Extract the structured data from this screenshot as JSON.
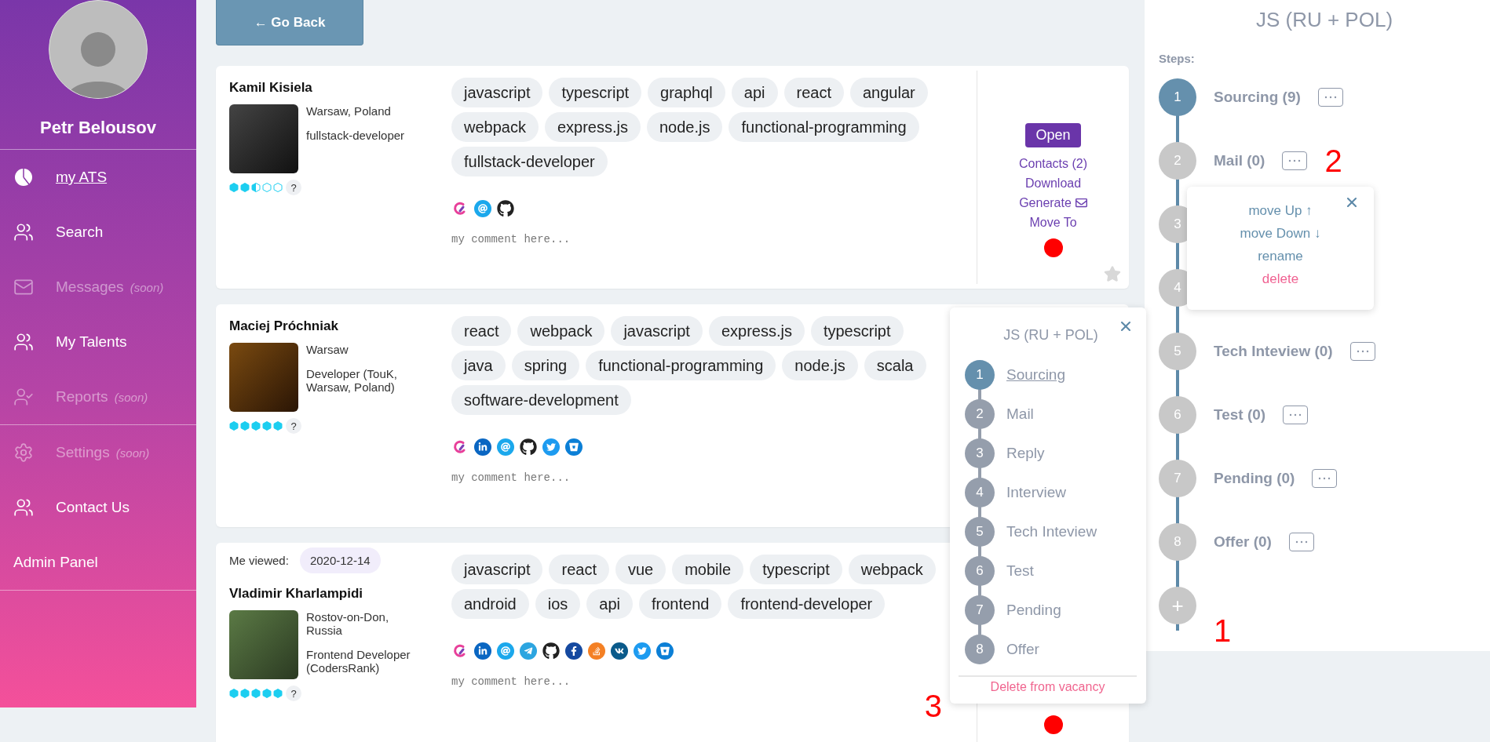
{
  "sidebar": {
    "user_name": "Petr Belousov",
    "groups": [
      [
        {
          "label": "my ATS",
          "kind": "chart",
          "selected": true,
          "disabled": false
        },
        {
          "label": "Search",
          "kind": "people",
          "selected": false,
          "disabled": false
        },
        {
          "label": "Messages",
          "note": "(soon)",
          "kind": "mail",
          "selected": false,
          "disabled": true
        },
        {
          "label": "My Talents",
          "kind": "people",
          "selected": false,
          "disabled": false
        },
        {
          "label": "Reports",
          "note": "(soon)",
          "kind": "person-check",
          "selected": false,
          "disabled": true
        }
      ],
      [
        {
          "label": "Settings",
          "note": "(soon)",
          "kind": "gear",
          "selected": false,
          "disabled": true
        },
        {
          "label": "Contact Us",
          "kind": "people",
          "selected": false,
          "disabled": false
        },
        {
          "label": "Admin Panel",
          "kind": "none",
          "selected": false,
          "disabled": false
        }
      ]
    ]
  },
  "back_button": "← Go Back",
  "candidates": [
    {
      "name": "Kamil Kisiela",
      "location": "Warsaw, Poland",
      "title": "fullstack-developer",
      "stars": 2.5,
      "rating_help": "?",
      "tags": [
        "javascript",
        "typescript",
        "graphql",
        "api",
        "react",
        "angular",
        "webpack",
        "express.js",
        "node.js",
        "functional-programming",
        "fullstack-developer"
      ],
      "links": [
        {
          "kind": "codersrank"
        },
        {
          "kind": "email"
        },
        {
          "kind": "github"
        }
      ],
      "comment_placeholder": "my comment here...",
      "open_button": "Open",
      "actions": [
        {
          "label": "Contacts (2)",
          "kind": "link"
        },
        {
          "label": "Download",
          "kind": "link"
        },
        {
          "label": "Generate",
          "kind": "mail-link"
        },
        {
          "label": "Move To",
          "kind": "link"
        }
      ],
      "color": "#ff0000",
      "favorite": false
    },
    {
      "name": "Maciej Próchniak",
      "location": "Warsaw",
      "title": "Developer (TouK, Warsaw, Poland)",
      "stars": 5,
      "rating_help": "?",
      "tags": [
        "react",
        "webpack",
        "javascript",
        "express.js",
        "typescript",
        "java",
        "spring",
        "functional-programming",
        "node.js",
        "scala",
        "software-development"
      ],
      "links": [
        {
          "kind": "codersrank"
        },
        {
          "kind": "linkedin"
        },
        {
          "kind": "email"
        },
        {
          "kind": "github"
        },
        {
          "kind": "twitter"
        },
        {
          "kind": "bitbucket"
        }
      ],
      "comment_placeholder": "my comment here..."
    },
    {
      "viewed": {
        "label": "Me viewed:",
        "date": "2020-12-14"
      },
      "name": "Vladimir Kharlampidi",
      "location": "Rostov-on-Don, Russia",
      "title": "Frontend Developer (CodersRank)",
      "stars": 5,
      "rating_help": "?",
      "tags": [
        "javascript",
        "react",
        "vue",
        "mobile",
        "typescript",
        "webpack",
        "android",
        "ios",
        "api",
        "frontend",
        "frontend-developer"
      ],
      "links": [
        {
          "kind": "codersrank"
        },
        {
          "kind": "linkedin"
        },
        {
          "kind": "email"
        },
        {
          "kind": "telegram"
        },
        {
          "kind": "github"
        },
        {
          "kind": "facebook"
        },
        {
          "kind": "stackoverflow"
        },
        {
          "kind": "vk"
        },
        {
          "kind": "twitter"
        },
        {
          "kind": "bitbucket"
        }
      ],
      "comment_placeholder": "my comment here...",
      "annotation": "3",
      "color": "#ff0000"
    }
  ],
  "move_to_popup": {
    "title": "JS (RU + POL)",
    "steps": [
      {
        "number": "1",
        "label": "Sourcing",
        "selected": true
      },
      {
        "number": "2",
        "label": "Mail",
        "selected": false
      },
      {
        "number": "3",
        "label": "Reply",
        "selected": false
      },
      {
        "number": "4",
        "label": "Interview",
        "selected": false
      },
      {
        "number": "5",
        "label": "Tech Inteview",
        "selected": false
      },
      {
        "number": "6",
        "label": "Test",
        "selected": false
      },
      {
        "number": "7",
        "label": "Pending",
        "selected": false
      },
      {
        "number": "8",
        "label": "Offer",
        "selected": false
      }
    ],
    "delete_link": "Delete from vacancy"
  },
  "pipeline": {
    "title": "JS (RU + POL)",
    "steps_label": "Steps:",
    "steps": [
      {
        "number": "1",
        "label": "Sourcing (9)",
        "selected": true
      },
      {
        "number": "2",
        "label": "Mail (0)",
        "selected": false,
        "annotation": "2"
      },
      {
        "number": "3",
        "selected": false
      },
      {
        "number": "4",
        "selected": false
      },
      {
        "number": "5",
        "label": "Tech Inteview (0)",
        "selected": false
      },
      {
        "number": "6",
        "label": "Test (0)",
        "selected": false
      },
      {
        "number": "7",
        "label": "Pending (0)",
        "selected": false
      },
      {
        "number": "8",
        "label": "Offer (0)",
        "selected": false
      }
    ],
    "add_button": "+",
    "add_annotation": "1",
    "step_menu": {
      "items": [
        {
          "label": "move Up ↑",
          "kind": "normal"
        },
        {
          "label": "move Down ↓",
          "kind": "normal"
        },
        {
          "label": "rename",
          "kind": "normal"
        },
        {
          "label": "delete",
          "kind": "danger"
        }
      ]
    }
  }
}
